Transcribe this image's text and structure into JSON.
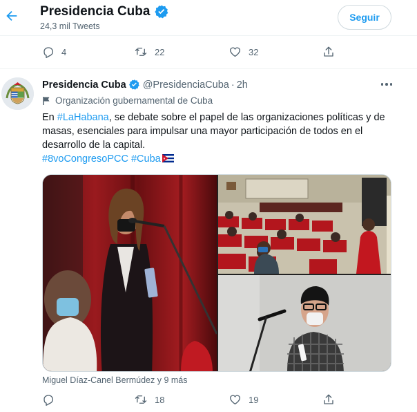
{
  "header": {
    "name": "Presidencia Cuba",
    "tweets_count": "24,3 mil Tweets",
    "follow_label": "Seguir"
  },
  "prev_tweet": {
    "replies": "4",
    "retweets": "22",
    "likes": "32"
  },
  "tweet": {
    "name": "Presidencia Cuba",
    "handle": "@PresidenciaCuba",
    "separator": "·",
    "time": "2h",
    "account_label": "Organización gubernamental de Cuba",
    "text_prefix": "En ",
    "text_link": "#LaHabana",
    "text_body": ", se debate sobre el papel de las organizaciones políticas y de masas, esenciales para impulsar una mayor participación de todos en el desarrollo de la capital.",
    "hashtag_1": "#8voCongresoPCC",
    "hashtag_2": "#Cuba",
    "tagged_people": "Miguel Díaz-Canel Bermúdez y 9 más",
    "replies": "",
    "retweets": "18",
    "likes": "19"
  },
  "colors": {
    "accent": "#1d9bf0",
    "secondary_text": "#536471",
    "verified": "#1d9bf0"
  },
  "icons": [
    "back-arrow-icon",
    "verified-badge-icon",
    "reply-icon",
    "retweet-icon",
    "like-icon",
    "share-icon",
    "more-icon",
    "flag-label-icon",
    "cuba-flag-icon",
    "cuba-coat-of-arms-icon"
  ]
}
